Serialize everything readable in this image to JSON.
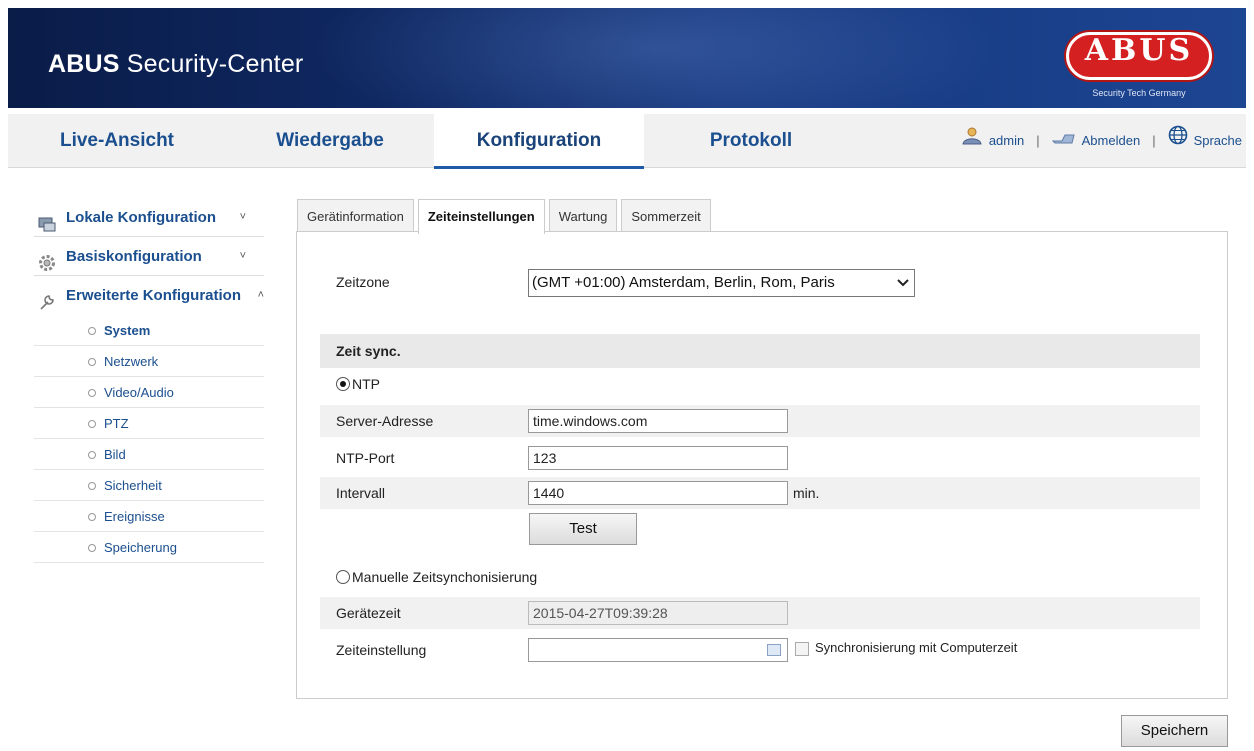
{
  "header": {
    "title_bold": "ABUS",
    "title_rest": " Security-Center",
    "logo_text": "ABUS",
    "logo_sub": "Security Tech Germany"
  },
  "nav": {
    "tabs": [
      {
        "label": "Live-Ansicht"
      },
      {
        "label": "Wiedergabe"
      },
      {
        "label": "Konfiguration",
        "active": true
      },
      {
        "label": "Protokoll"
      }
    ],
    "user": "admin",
    "logout": "Abmelden",
    "language": "Sprache",
    "separator": "|"
  },
  "sidebar": {
    "groups": [
      {
        "label": "Lokale Konfiguration",
        "icon": "monitor-icon",
        "chevron": "˅"
      },
      {
        "label": "Basiskonfiguration",
        "icon": "gear-icon",
        "chevron": "˅"
      },
      {
        "label": "Erweiterte Konfiguration",
        "icon": "wrench-icon",
        "chevron": "˄"
      }
    ],
    "items": [
      {
        "label": "System",
        "active": true
      },
      {
        "label": "Netzwerk"
      },
      {
        "label": "Video/Audio"
      },
      {
        "label": "PTZ"
      },
      {
        "label": "Bild"
      },
      {
        "label": "Sicherheit"
      },
      {
        "label": "Ereignisse"
      },
      {
        "label": "Speicherung"
      }
    ]
  },
  "tabs": [
    {
      "label": "Gerätinformation"
    },
    {
      "label": "Zeiteinstellungen",
      "active": true
    },
    {
      "label": "Wartung"
    },
    {
      "label": "Sommerzeit"
    }
  ],
  "form": {
    "timezone_label": "Zeitzone",
    "timezone_value": "(GMT +01:00) Amsterdam, Berlin, Rom, Paris",
    "sync_header": "Zeit sync.",
    "ntp_label": "NTP",
    "ntp_checked": true,
    "server_label": "Server-Adresse",
    "server_value": "time.windows.com",
    "port_label": "NTP-Port",
    "port_value": "123",
    "interval_label": "Intervall",
    "interval_value": "1440",
    "interval_unit": "min.",
    "test_button": "Test",
    "manual_label": "Manuelle Zeitsynchonisierung",
    "manual_checked": false,
    "device_time_label": "Gerätezeit",
    "device_time_value": "2015-04-27T09:39:28",
    "set_time_label": "Zeiteinstellung",
    "set_time_value": "",
    "sync_pc_label": "Synchronisierung mit Computerzeit"
  },
  "save_button": "Speichern"
}
